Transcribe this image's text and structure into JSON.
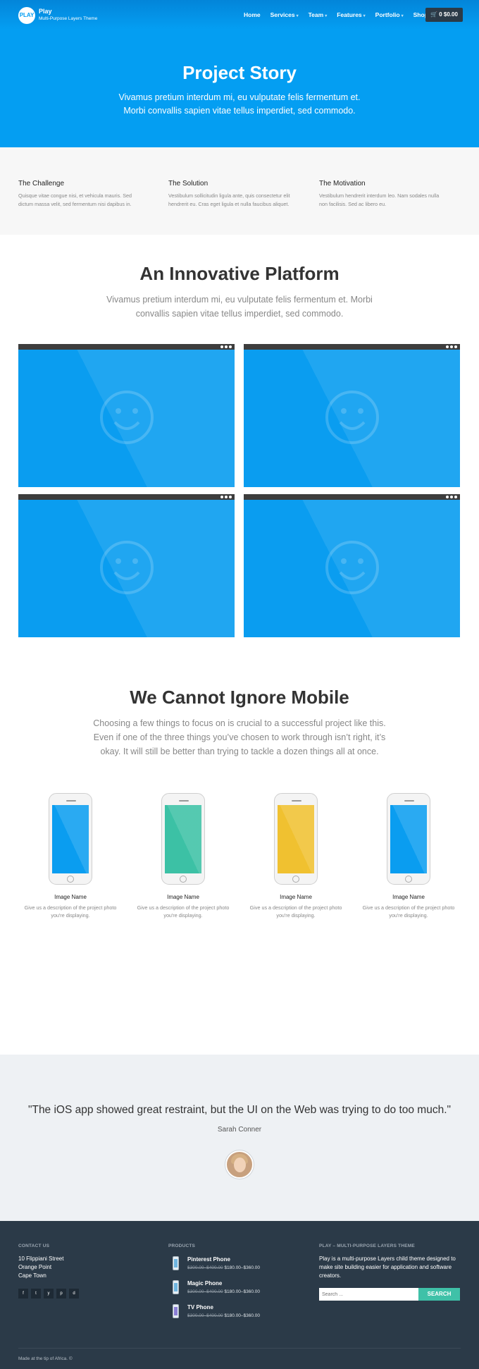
{
  "header": {
    "logo": "PLAY",
    "brand_name": "Play",
    "tagline": "Multi-Purpose Layers Theme",
    "nav": [
      "Home",
      "Services",
      "Team",
      "Features",
      "Portfolio",
      "Shop"
    ],
    "cart_count": "0",
    "cart_total": "$0.00"
  },
  "hero": {
    "title": "Project Story",
    "subtitle_line1": "Vivamus pretium interdum mi, eu vulputate felis fermentum et.",
    "subtitle_line2": "Morbi convallis sapien vitae tellus imperdiet, sed commodo."
  },
  "features": [
    {
      "title": "The Challenge",
      "text_line1": "Quisque vitae congue nisi, et vehicula mauris. Sed",
      "text_line2": "dictum massa velit, sed fermentum nisi dapibus in."
    },
    {
      "title": "The Solution",
      "text_line1": "Vestibulum sollicitudin ligula ante, quis consectetur elit",
      "text_line2": "hendrerit eu. Cras eget ligula et nulla faucibus aliquet."
    },
    {
      "title": "The Motivation",
      "text_line1": "Vestibulum hendrerit interdum leo. Nam sodales nulla",
      "text_line2": "non facilisis. Sed ac libero eu."
    }
  ],
  "platform": {
    "title": "An Innovative Platform",
    "subtitle_line1": "Vivamus pretium interdum mi, eu vulputate felis fermentum et. Morbi",
    "subtitle_line2": "convallis sapien vitae tellus imperdiet, sed commodo."
  },
  "mobile": {
    "title": "We Cannot Ignore Mobile",
    "subtitle_line1": "Choosing a few things to focus on is crucial to a successful project like this.",
    "subtitle_line2": "Even if one of the three things you’ve chosen to work through isn’t right, it’s",
    "subtitle_line3": "okay. It will still be better than trying to tackle a dozen things all at once.",
    "phones": [
      {
        "name": "Image Name",
        "desc_line1": "Give us a description of the project photo",
        "desc_line2": "you're displaying.",
        "color": "#0a9df0"
      },
      {
        "name": "Image Name",
        "desc_line1": "Give us a description of the project photo",
        "desc_line2": "you're displaying.",
        "color": "#3cc1a5"
      },
      {
        "name": "Image Name",
        "desc_line1": "Give us a description of the project photo",
        "desc_line2": "you're displaying.",
        "color": "#f0c130"
      },
      {
        "name": "Image Name",
        "desc_line1": "Give us a description of the project photo",
        "desc_line2": "you're displaying.",
        "color": "#0a9df0"
      }
    ]
  },
  "testimonial": {
    "quote": "\"The iOS app showed great restraint, but the UI on the Web was trying to do too much.\"",
    "author": "Sarah Conner"
  },
  "footer": {
    "contact_heading": "CONTACT US",
    "address": [
      "10 Flippiani Street",
      "Orange Point",
      "Cape Town"
    ],
    "social_icons": [
      "f",
      "t",
      "y",
      "p",
      "d"
    ],
    "products_heading": "PRODUCTS",
    "products": [
      {
        "name": "Pinterest Phone",
        "old_price": "$300.00–$400.00",
        "new_price": "$180.00–$360.00",
        "color": "#6fb5e0"
      },
      {
        "name": "Magic Phone",
        "old_price": "$300.00–$400.00",
        "new_price": "$180.00–$360.00",
        "color": "#6fb5e0"
      },
      {
        "name": "TV Phone",
        "old_price": "$300.00–$400.00",
        "new_price": "$180.00–$360.00",
        "color": "#8b7fd6"
      }
    ],
    "about_heading": "PLAY – MULTI-PURPOSE LAYERS THEME",
    "about_text": "Play is a multi-purpose Layers child theme designed to make site building easier for application and software creators.",
    "search_placeholder": "Search ...",
    "search_button": "SEARCH",
    "copyright": "Made at the tip of Africa. ©"
  }
}
